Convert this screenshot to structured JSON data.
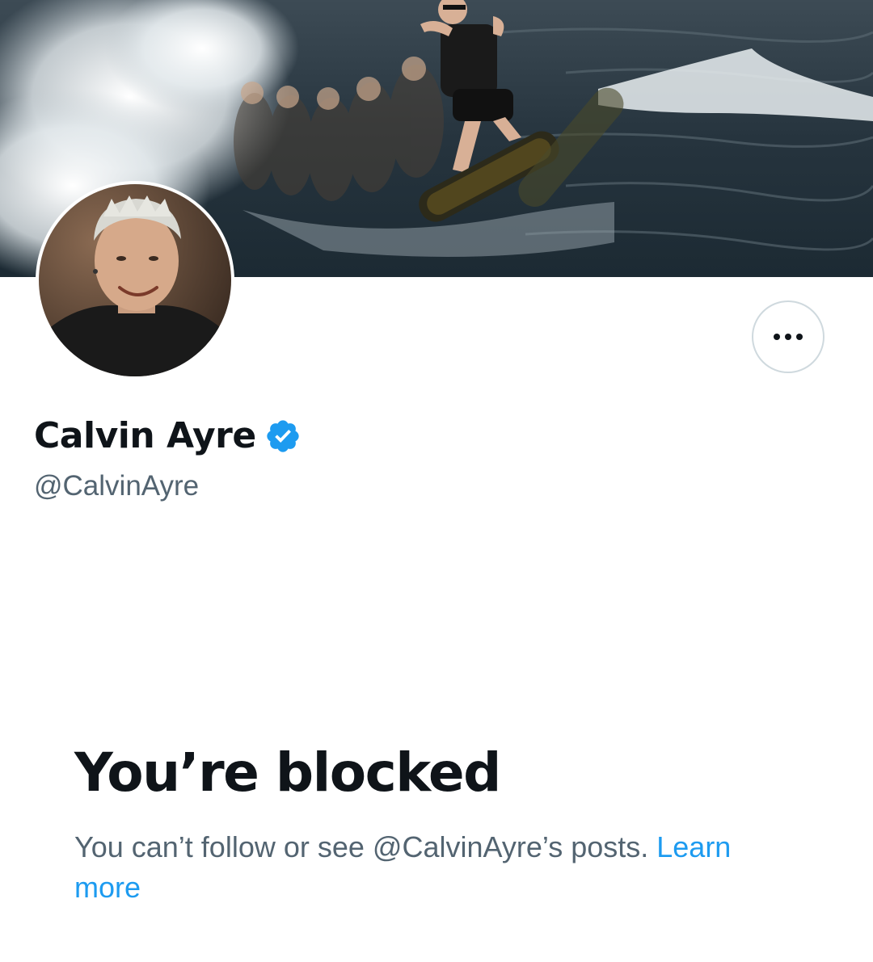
{
  "profile": {
    "display_name": "Calvin Ayre",
    "handle": "@CalvinAyre",
    "verified": true,
    "verified_color": "#1d9bf0"
  },
  "banner": {
    "description": "cover-photo-wakeboarder"
  },
  "actions": {
    "more_icon": "more-horizontal-icon"
  },
  "blocked": {
    "title": "You’re blocked",
    "message_prefix": "You can’t follow or see @CalvinAyre’s posts. ",
    "learn_more_label": "Learn more"
  },
  "colors": {
    "text_primary": "#0f1419",
    "text_secondary": "#536471",
    "link": "#1d9bf0",
    "border": "#cfd9de"
  }
}
